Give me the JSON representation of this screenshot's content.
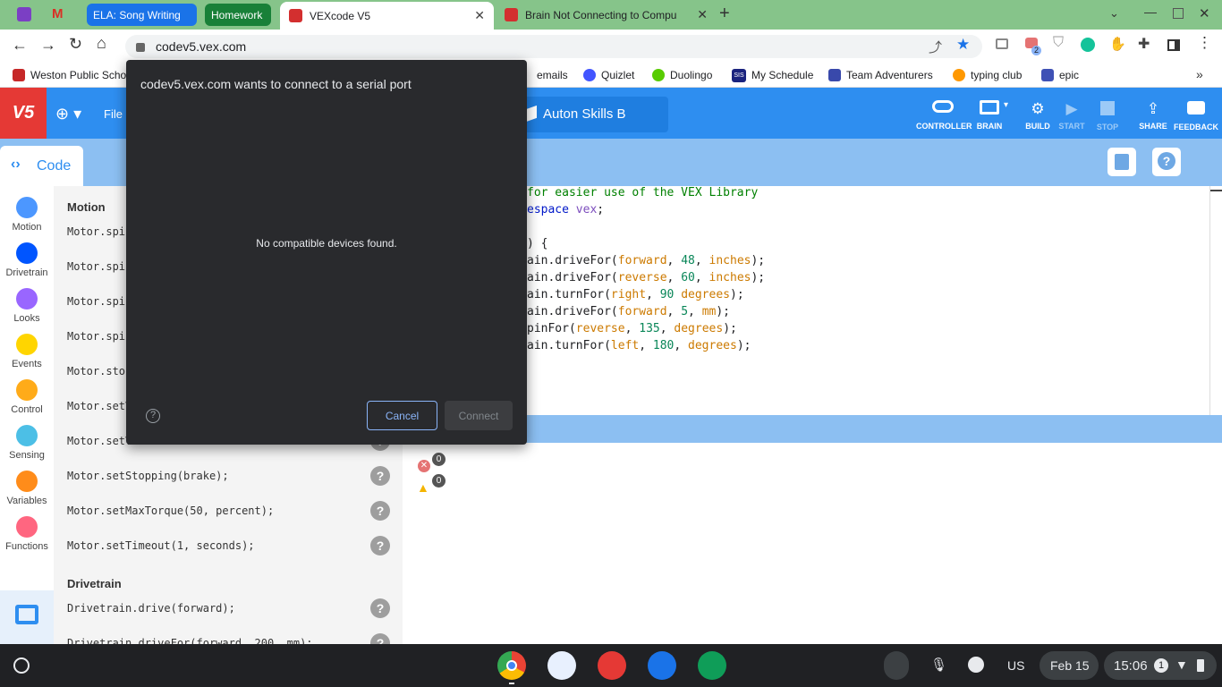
{
  "browser": {
    "tabs": [
      {
        "label": "ELA: Song Writing",
        "color": "#1a73e8"
      },
      {
        "label": "Homework",
        "color": "#188038"
      },
      {
        "label": "VEXcode V5",
        "active": true
      },
      {
        "label": "Brain Not Connecting to Compu"
      }
    ],
    "url": "codev5.vex.com",
    "extension_badge": "2",
    "bookmarks": [
      "Weston Public Scho",
      "emails",
      "Quizlet",
      "Duolingo",
      "My Schedule",
      "Team Adventurers",
      "typing club",
      "epic"
    ],
    "sis_icon_text": "SIS"
  },
  "vex": {
    "logo": "V5",
    "file_menu": "File",
    "project_name": "Auton Skills B",
    "toolbar": [
      {
        "label": "CONTROLLER",
        "disabled": false
      },
      {
        "label": "BRAIN",
        "disabled": false
      },
      {
        "label": "BUILD",
        "disabled": false
      },
      {
        "label": "START",
        "disabled": true
      },
      {
        "label": "STOP",
        "disabled": true
      },
      {
        "label": "SHARE",
        "disabled": false
      },
      {
        "label": "FEEDBACK",
        "disabled": false
      }
    ],
    "code_tab": "Code",
    "categories": [
      {
        "label": "Motion",
        "color": "#4c97ff"
      },
      {
        "label": "Drivetrain",
        "color": "#0055ff"
      },
      {
        "label": "Looks",
        "color": "#9966ff"
      },
      {
        "label": "Events",
        "color": "#ffd500"
      },
      {
        "label": "Control",
        "color": "#ffab19"
      },
      {
        "label": "Sensing",
        "color": "#4cbfe6"
      },
      {
        "label": "Variables",
        "color": "#ff8c1a"
      },
      {
        "label": "Functions",
        "color": "#ff6680"
      }
    ],
    "palette": {
      "heading_motion": "Motion",
      "motion_items": [
        "Motor.spin",
        "Motor.spin",
        "Motor.spin",
        "Motor.spin",
        "Motor.stop",
        "Motor.setV",
        "Motor.setV",
        "Motor.setStopping(brake);",
        "Motor.setMaxTorque(50, percent);",
        "Motor.setTimeout(1, seconds);"
      ],
      "heading_drivetrain": "Drivetrain",
      "drivetrain_items": [
        "Drivetrain.drive(forward);",
        "Drivetrain.driveFor(forward, 200, mm);"
      ],
      "help_glyph": "?"
    },
    "code_lines": [
      [
        {
          "t": " for easier use of the VEX Library",
          "c": "cm"
        }
      ],
      [
        {
          "t": "espace ",
          "c": "kw"
        },
        {
          "t": "vex",
          "c": "ns"
        },
        {
          "t": ";",
          "c": ""
        }
      ],
      [
        {
          "t": "",
          "c": ""
        }
      ],
      [
        {
          "t": ") {",
          "c": ""
        }
      ],
      [
        {
          "t": "ain.driveFor(",
          "c": ""
        },
        {
          "t": "forward",
          "c": "tk"
        },
        {
          "t": ", ",
          "c": ""
        },
        {
          "t": "48",
          "c": "nm"
        },
        {
          "t": ", ",
          "c": ""
        },
        {
          "t": "inches",
          "c": "tk"
        },
        {
          "t": ");",
          "c": ""
        }
      ],
      [
        {
          "t": "ain.driveFor(",
          "c": ""
        },
        {
          "t": "reverse",
          "c": "tk"
        },
        {
          "t": ", ",
          "c": ""
        },
        {
          "t": "60",
          "c": "nm"
        },
        {
          "t": ", ",
          "c": ""
        },
        {
          "t": "inches",
          "c": "tk"
        },
        {
          "t": ");",
          "c": ""
        }
      ],
      [
        {
          "t": "ain.turnFor(",
          "c": ""
        },
        {
          "t": "right",
          "c": "tk"
        },
        {
          "t": ", ",
          "c": ""
        },
        {
          "t": "90",
          "c": "nm"
        },
        {
          "t": " ",
          "c": ""
        },
        {
          "t": "degrees",
          "c": "tk"
        },
        {
          "t": ");",
          "c": ""
        }
      ],
      [
        {
          "t": "ain.driveFor(",
          "c": ""
        },
        {
          "t": "forward",
          "c": "tk"
        },
        {
          "t": ", ",
          "c": ""
        },
        {
          "t": "5",
          "c": "nm"
        },
        {
          "t": ", ",
          "c": ""
        },
        {
          "t": "mm",
          "c": "tk"
        },
        {
          "t": ");",
          "c": ""
        }
      ],
      [
        {
          "t": "pinFor(",
          "c": ""
        },
        {
          "t": "reverse",
          "c": "tk"
        },
        {
          "t": ", ",
          "c": ""
        },
        {
          "t": "135",
          "c": "nm"
        },
        {
          "t": ", ",
          "c": ""
        },
        {
          "t": "degrees",
          "c": "tk"
        },
        {
          "t": ");",
          "c": ""
        }
      ],
      [
        {
          "t": "ain.turnFor(",
          "c": ""
        },
        {
          "t": "left",
          "c": "tk"
        },
        {
          "t": ", ",
          "c": ""
        },
        {
          "t": "180",
          "c": "nm"
        },
        {
          "t": ", ",
          "c": ""
        },
        {
          "t": "degrees",
          "c": "tk"
        },
        {
          "t": ");",
          "c": ""
        }
      ]
    ],
    "error_count": "0",
    "warning_count": "0"
  },
  "dialog": {
    "title": "codev5.vex.com wants to connect to a serial port",
    "message": "No compatible devices found.",
    "help_glyph": "?",
    "cancel_label": "Cancel",
    "connect_label": "Connect"
  },
  "shelf": {
    "keyboard_layout": "US",
    "date": "Feb 15",
    "time": "15:06",
    "notification_count": "1"
  }
}
